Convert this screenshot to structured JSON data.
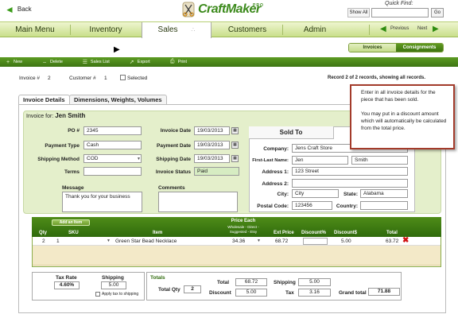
{
  "topbar": {
    "back_label": "Back",
    "logo_text": "CraftMaker",
    "logo_sub": "PRO",
    "show_all": "Show All",
    "quick_find_label": "Quick Find:",
    "quick_find_value": "",
    "go_label": "Go"
  },
  "nav": {
    "items": [
      "Main Menu",
      "Inventory",
      "Sales",
      "Customers",
      "Admin"
    ],
    "active": "Sales",
    "previous": "Previous",
    "next": "Next"
  },
  "segment": {
    "invoices": "Invoices",
    "consignments": "Consignments"
  },
  "toolbar": {
    "new": "New",
    "delete": "Delete",
    "sales_list": "Sales List",
    "export": "Export",
    "print": "Print"
  },
  "status": {
    "invoice_label": "Invoice #",
    "invoice_value": "2",
    "customer_label": "Customer #",
    "customer_value": "1",
    "selected_label": "Selected",
    "record_info": "Record 2 of 2 records, showing all records."
  },
  "tabs": [
    "Invoice Details",
    "Dimensions, Weights, Volumes"
  ],
  "invoice": {
    "for_label": "Invoice for:",
    "for_name": "Jen Smith",
    "po_label": "PO #",
    "po_value": "2345",
    "payment_type_label": "Payment Type",
    "payment_type_value": "Cash",
    "shipping_method_label": "Shipping Method",
    "shipping_method_value": "COD",
    "terms_label": "Terms",
    "terms_value": "",
    "invoice_date_label": "Invoice Date",
    "invoice_date_value": "19/03/2013",
    "payment_date_label": "Payment Date",
    "payment_date_value": "19/03/2013",
    "shipping_date_label": "Shipping Date",
    "shipping_date_value": "19/03/2013",
    "invoice_status_label": "Invoice Status",
    "invoice_status_value": "Paid",
    "message_label": "Message",
    "message_value": "Thank you for your business",
    "comments_label": "Comments",
    "comments_value": ""
  },
  "sold_to": {
    "title": "Sold To",
    "company_label": "Company:",
    "company_value": "Jens Craft Store",
    "name_label": "First-Last Name:",
    "first_name": "Jen",
    "last_name": "Smith",
    "address1_label": "Address 1:",
    "address1_value": "123 Street",
    "address2_label": "Address 2:",
    "address2_value": "",
    "city_label": "City:",
    "city_value": "City",
    "state_label": "State:",
    "state_value": "Alabama",
    "postal_label": "Postal Code:",
    "postal_value": "123456",
    "country_label": "Country:",
    "country_value": ""
  },
  "items": {
    "add_label": "Add an Item",
    "headers": {
      "qty": "Qty",
      "sku": "SKU",
      "item": "Item",
      "price_each": "Price Each",
      "price_sub": "Wholesale - Direct -",
      "price_sub2": "Suggested - Etsy",
      "ext_price": "Ext Price",
      "discount_pct": "Discount%",
      "discount_amt": "Discount$",
      "total": "Total"
    },
    "rows": [
      {
        "qty": "2",
        "sku": "1",
        "item": "Green Star Bead Necklace",
        "price": "34.36",
        "ext_price": "68.72",
        "discount_pct": "",
        "discount_amt": "5.00",
        "total": "63.72"
      }
    ]
  },
  "totals": {
    "tax_rate_label": "Tax Rate",
    "tax_rate_value": "4.60%",
    "shipping_label": "Shipping",
    "shipping_value": "5.00",
    "apply_tax_label": "Apply tax to shipping",
    "totals_title": "Totals",
    "total_qty_label": "Total Qty",
    "total_qty_value": "2",
    "total_label": "Total",
    "total_value": "68.72",
    "discount_label": "Discount",
    "discount_value": "5.00",
    "shipping2_label": "Shipping",
    "shipping2_value": "5.00",
    "tax_label": "Tax",
    "tax_value": "3.16",
    "grand_total_label": "Grand total",
    "grand_total_value": "71.88"
  },
  "tooltip": {
    "line1": "Enter in all invoice details for the piece that has been sold.",
    "line2": "You may put in a discount amount which will automatically be calculated from the total price."
  }
}
